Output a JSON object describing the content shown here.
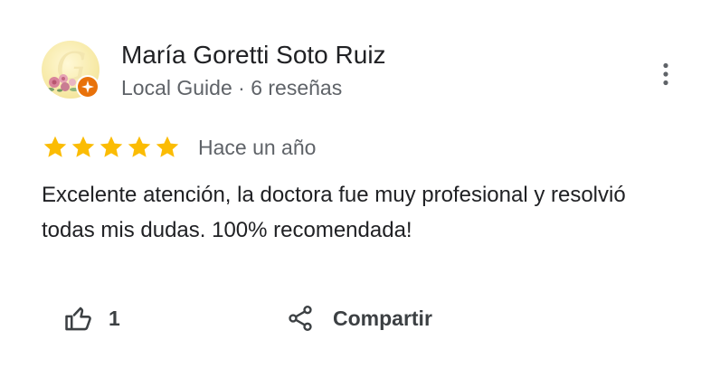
{
  "reviewer": {
    "name": "María Goretti Soto Ruiz",
    "meta": "Local Guide · 6 reseñas",
    "avatar_icon": "avatar-floral-g",
    "badge_icon": "local-guide-badge-icon"
  },
  "review": {
    "rating": 5,
    "max_rating": 5,
    "date": "Hace un año",
    "text": "Excelente atención, la doctora fue muy profesional y resolvió todas mis dudas. 100% recomendada!"
  },
  "actions": {
    "like_count": "1",
    "share_label": "Compartir"
  },
  "colors": {
    "star": "#fbbc04",
    "badge": "#e8710a",
    "primary_text": "#202124",
    "secondary_text": "#5f6368"
  }
}
